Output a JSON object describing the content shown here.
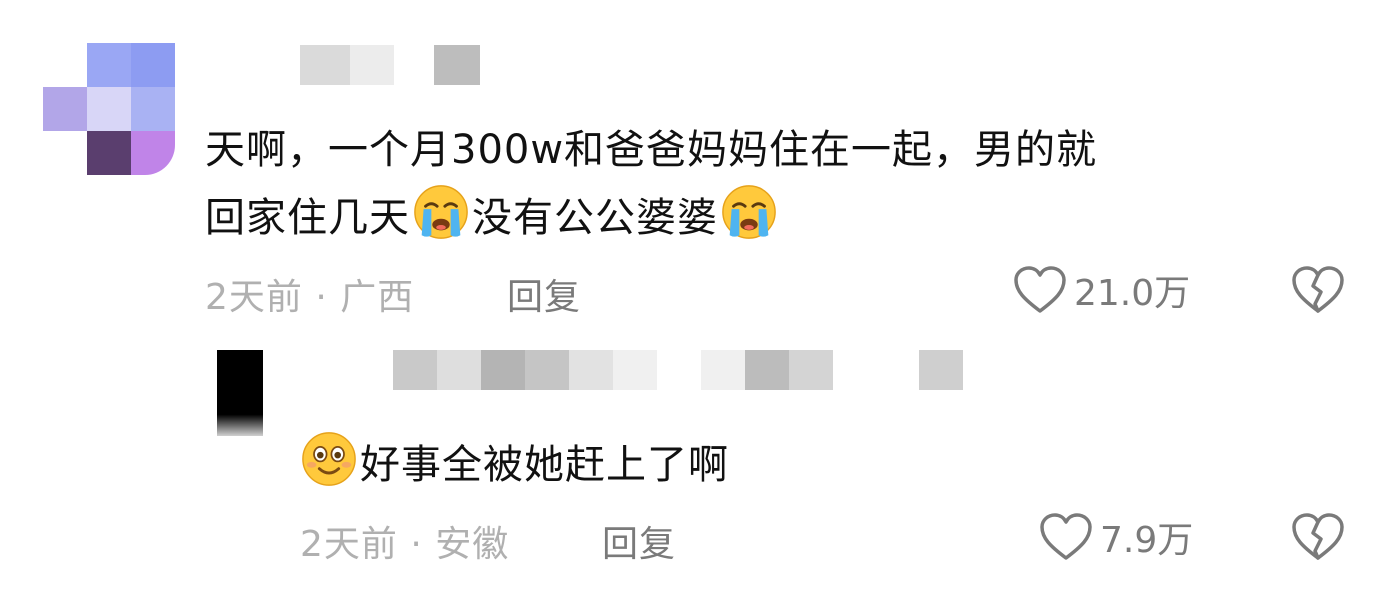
{
  "comments": [
    {
      "text_line1": "天啊，一个月300w和爸爸妈妈住在一起，男的就",
      "text_line2_a": "回家住几天",
      "text_line2_b": "没有公公婆婆",
      "emoji": "loudly-crying-face",
      "time": "2天前",
      "location": "广西",
      "reply_label": "回复",
      "likes": "21.0万"
    },
    {
      "text_a": "好事全被她赶上了啊",
      "emoji": "smiling-face-with-smiling-eyes",
      "time": "2天前",
      "location": "安徽",
      "reply_label": "回复",
      "likes": "7.9万"
    }
  ],
  "icons": {
    "like": "heart-outline-icon",
    "dislike": "broken-heart-icon"
  },
  "colors": {
    "meta_text": "#b0b0b0",
    "action_text": "#7a7a7a",
    "body_text": "#111111"
  }
}
